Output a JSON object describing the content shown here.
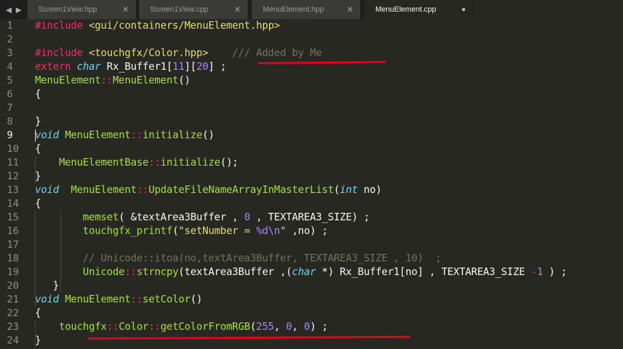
{
  "tabs": [
    {
      "label": "Screen1View.hpp",
      "close": "✕",
      "active": false
    },
    {
      "label": "Screen1View.cpp",
      "close": "✕",
      "active": false
    },
    {
      "label": "MenuElement.hpp",
      "close": "✕",
      "active": false
    },
    {
      "label": "MenuElement.cpp",
      "close": "●",
      "active": true
    }
  ],
  "nav": {
    "left": "◀",
    "right": "▶"
  },
  "line_numbers": [
    "1",
    "2",
    "3",
    "4",
    "5",
    "6",
    "7",
    "8",
    "9",
    "10",
    "11",
    "12",
    "13",
    "14",
    "15",
    "16",
    "17",
    "18",
    "19",
    "20",
    "21",
    "22",
    "23",
    "24"
  ],
  "active_line": "9",
  "code": {
    "l1": [
      [
        "kw",
        "#include"
      ],
      [
        "plain",
        " "
      ],
      [
        "str",
        "<gui/containers/MenuElement.hpp>"
      ]
    ],
    "l2": [],
    "l3": [
      [
        "kw",
        "#include"
      ],
      [
        "plain",
        " "
      ],
      [
        "str",
        "<touchgfx/Color.hpp>"
      ],
      [
        "plain",
        "    "
      ],
      [
        "cmt",
        "/// Added by Me"
      ]
    ],
    "l4": [
      [
        "kw",
        "extern"
      ],
      [
        "plain",
        " "
      ],
      [
        "typ",
        "char"
      ],
      [
        "plain",
        " Rx_Buffer1["
      ],
      [
        "num",
        "11"
      ],
      [
        "plain",
        "]["
      ],
      [
        "num",
        "20"
      ],
      [
        "plain",
        "] ;"
      ]
    ],
    "l5": [
      [
        "fn",
        "MenuElement"
      ],
      [
        "kw",
        "::"
      ],
      [
        "fn",
        "MenuElement"
      ],
      [
        "plain",
        "()"
      ]
    ],
    "l6": [
      [
        "plain",
        "{"
      ]
    ],
    "l7": [],
    "l8": [
      [
        "plain",
        "}"
      ]
    ],
    "l9": [
      [
        "typ",
        "void"
      ],
      [
        "plain",
        " "
      ],
      [
        "fn",
        "MenuElement"
      ],
      [
        "kw",
        "::"
      ],
      [
        "fn",
        "initialize"
      ],
      [
        "plain",
        "()"
      ]
    ],
    "l10": [
      [
        "plain",
        "{"
      ]
    ],
    "l11": [
      [
        "plain",
        "    "
      ],
      [
        "fn",
        "MenuElementBase"
      ],
      [
        "kw",
        "::"
      ],
      [
        "fn",
        "initialize"
      ],
      [
        "plain",
        "();"
      ]
    ],
    "l12": [
      [
        "plain",
        "}"
      ]
    ],
    "l13": [
      [
        "typ",
        "void"
      ],
      [
        "plain",
        "  "
      ],
      [
        "fn",
        "MenuElement"
      ],
      [
        "kw",
        "::"
      ],
      [
        "fn",
        "UpdateFileNameArrayInMasterList"
      ],
      [
        "plain",
        "("
      ],
      [
        "typ",
        "int"
      ],
      [
        "plain",
        " no)"
      ]
    ],
    "l14": [
      [
        "plain",
        "{"
      ]
    ],
    "l15": [
      [
        "plain",
        "        "
      ],
      [
        "fn",
        "memset"
      ],
      [
        "plain",
        "( &textArea3Buffer , "
      ],
      [
        "num",
        "0"
      ],
      [
        "plain",
        " , TEXTAREA3_SIZE) ;"
      ]
    ],
    "l16": [
      [
        "plain",
        "        "
      ],
      [
        "fn",
        "touchgfx_printf"
      ],
      [
        "plain",
        "("
      ],
      [
        "str",
        "\"setNumber = "
      ],
      [
        "num",
        "%d\\n"
      ],
      [
        "str",
        "\""
      ],
      [
        "plain",
        " ,no) ;"
      ]
    ],
    "l17": [],
    "l18": [
      [
        "plain",
        "        "
      ],
      [
        "cmt",
        "// Unicode::itoa(no,textArea3Buffer, TEXTAREA3_SIZE , 10)  ;"
      ]
    ],
    "l19": [
      [
        "plain",
        "        "
      ],
      [
        "fn",
        "Unicode"
      ],
      [
        "kw",
        "::"
      ],
      [
        "fn",
        "strncpy"
      ],
      [
        "plain",
        "(textArea3Buffer ,("
      ],
      [
        "typ",
        "char"
      ],
      [
        "plain",
        " *) Rx_Buffer1[no] , TEXTAREA3_SIZE "
      ],
      [
        "kw",
        "-"
      ],
      [
        "num",
        "1"
      ],
      [
        "plain",
        " ) ;"
      ]
    ],
    "l20": [
      [
        "plain",
        "   }"
      ]
    ],
    "l21": [
      [
        "typ",
        "void"
      ],
      [
        "plain",
        " "
      ],
      [
        "fn",
        "MenuElement"
      ],
      [
        "kw",
        "::"
      ],
      [
        "fn",
        "setColor"
      ],
      [
        "plain",
        "()"
      ]
    ],
    "l22": [
      [
        "plain",
        "{"
      ]
    ],
    "l23": [
      [
        "plain",
        "    "
      ],
      [
        "fn",
        "touchgfx"
      ],
      [
        "kw",
        "::"
      ],
      [
        "fn",
        "Color"
      ],
      [
        "kw",
        "::"
      ],
      [
        "fn",
        "getColorFromRGB"
      ],
      [
        "plain",
        "("
      ],
      [
        "num",
        "255"
      ],
      [
        "plain",
        ", "
      ],
      [
        "num",
        "0"
      ],
      [
        "plain",
        ", "
      ],
      [
        "num",
        "0"
      ],
      [
        "plain",
        ") ;"
      ]
    ],
    "l24": [
      [
        "plain",
        "}"
      ]
    ]
  },
  "colors": {
    "background": "#272822",
    "keyword": "#f92672",
    "type": "#66d9ef",
    "function": "#a6e22e",
    "string": "#e6db74",
    "number": "#ae81ff",
    "comment": "#75715e",
    "annotation": "#e8001c"
  }
}
